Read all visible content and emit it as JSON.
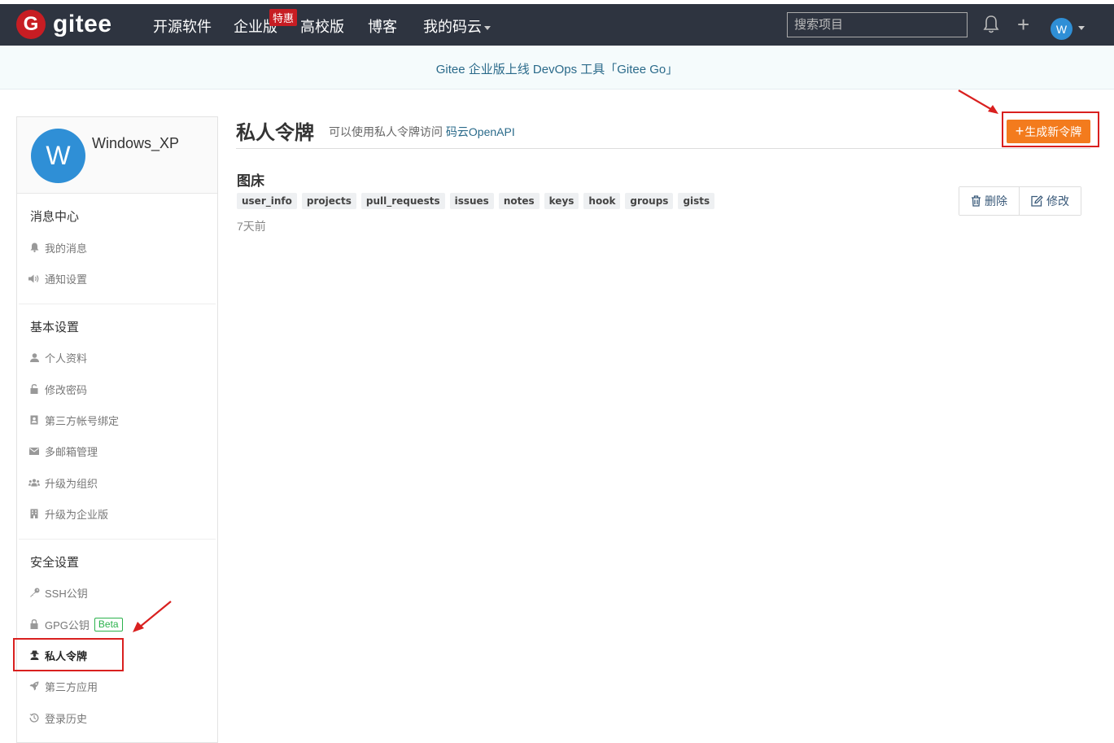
{
  "topnav": {
    "logo_letter": "G",
    "logo_text": "gitee",
    "items": [
      "开源软件",
      "企业版",
      "高校版",
      "博客",
      "我的码云"
    ],
    "enterprise_badge": "特惠",
    "search_placeholder": "搜索项目",
    "avatar_letter": "W",
    "icons": [
      "bell-icon",
      "plus-icon",
      "chevron-down-icon"
    ]
  },
  "announcement": "Gitee 企业版上线 DevOps 工具「Gitee Go」",
  "sidebar": {
    "avatar_letter": "W",
    "username": "Windows_XP",
    "sections": [
      {
        "title": "消息中心",
        "items": [
          {
            "label": "我的消息",
            "icon": "bell-icon"
          },
          {
            "label": "通知设置",
            "icon": "volume-icon"
          }
        ]
      },
      {
        "title": "基本设置",
        "items": [
          {
            "label": "个人资料",
            "icon": "user-icon"
          },
          {
            "label": "修改密码",
            "icon": "unlock-icon"
          },
          {
            "label": "第三方帐号绑定",
            "icon": "contact-card-icon"
          },
          {
            "label": "多邮箱管理",
            "icon": "envelope-icon"
          },
          {
            "label": "升级为组织",
            "icon": "users-icon"
          },
          {
            "label": "升级为企业版",
            "icon": "building-icon"
          }
        ]
      },
      {
        "title": "安全设置",
        "items": [
          {
            "label": "SSH公钥",
            "icon": "key-icon"
          },
          {
            "label": "GPG公钥",
            "icon": "lock-icon",
            "badge": "Beta"
          },
          {
            "label": "私人令牌",
            "icon": "user-secret-icon",
            "active": true
          },
          {
            "label": "第三方应用",
            "icon": "rocket-icon"
          },
          {
            "label": "登录历史",
            "icon": "history-icon"
          }
        ]
      }
    ]
  },
  "main": {
    "title": "私人令牌",
    "description": "可以使用私人令牌访问",
    "description_link": "码云OpenAPI",
    "generate_button": "生成新令牌",
    "token": {
      "name": "图床",
      "scopes": [
        "user_info",
        "projects",
        "pull_requests",
        "issues",
        "notes",
        "keys",
        "hook",
        "groups",
        "gists"
      ],
      "time": "7天前",
      "delete_label": "删除",
      "edit_label": "修改"
    }
  },
  "colors": {
    "topbar": "#2e3440",
    "brand_red": "#c71d23",
    "accent_orange": "#f37b1d",
    "annotation_red": "#d9201f",
    "link": "#2a6a8a",
    "beta_green": "#2bb24c"
  }
}
